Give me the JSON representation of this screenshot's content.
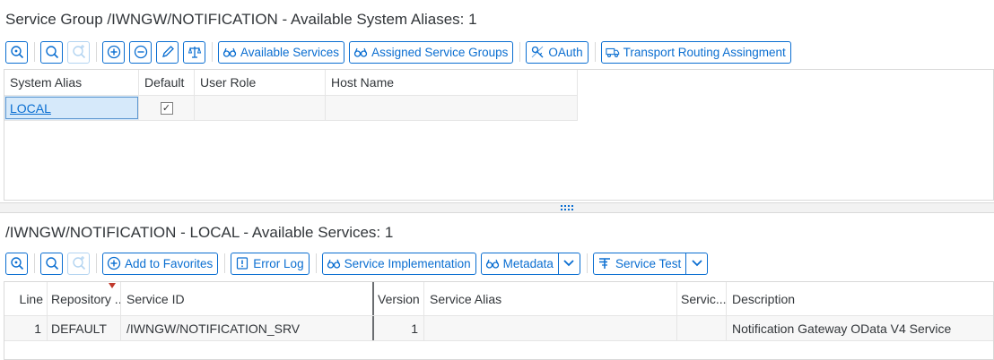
{
  "top": {
    "title": "Service Group /IWNGW/NOTIFICATION - Available System Aliases: 1",
    "toolbar": {
      "available_services": "Available Services",
      "assigned_service_groups": "Assigned Service Groups",
      "oauth": "OAuth",
      "transport_routing": "Transport Routing Assingment"
    },
    "columns": [
      "System Alias",
      "Default",
      "User Role",
      "Host Name"
    ],
    "rows": [
      {
        "system_alias": "LOCAL",
        "default": true,
        "user_role": "",
        "host_name": ""
      }
    ]
  },
  "bottom": {
    "title": "/IWNGW/NOTIFICATION - LOCAL - Available Services: 1",
    "toolbar": {
      "add_to_favorites": "Add to Favorites",
      "error_log": "Error Log",
      "service_implementation": "Service Implementation",
      "metadata": "Metadata",
      "service_test": "Service Test"
    },
    "columns": [
      "Line",
      "Repository ...",
      "Service ID",
      "Version",
      "Service Alias",
      "Servic...",
      "Description"
    ],
    "rows": [
      {
        "line": "1",
        "repository": "DEFAULT",
        "service_id": "/IWNGW/NOTIFICATION_SRV",
        "version": "1",
        "service_alias": "",
        "service": "",
        "description": "Notification Gateway OData V4 Service"
      }
    ]
  },
  "colors": {
    "accent": "#0a6ed1",
    "selection": "#d6e9fa",
    "sort_marker": "#c0392b"
  }
}
